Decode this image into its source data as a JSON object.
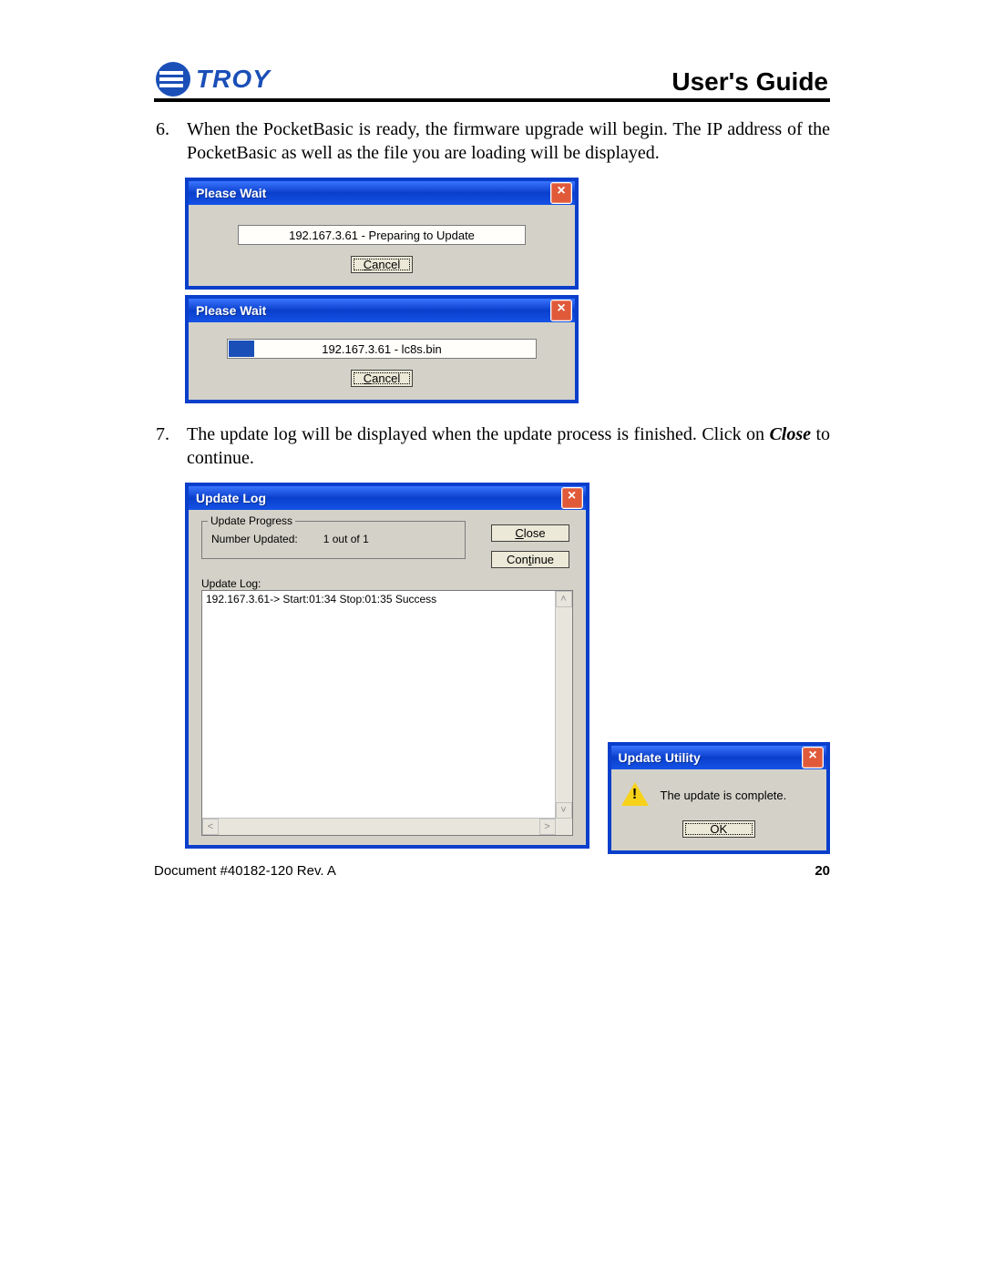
{
  "header": {
    "brand": "TROY",
    "title": "User's Guide"
  },
  "steps": {
    "s6": {
      "num": "6.",
      "text": "When the PocketBasic is ready, the firmware upgrade will begin. The IP address of the PocketBasic as well as the file you are loading will be displayed."
    },
    "s7": {
      "num": "7.",
      "text_a": "The update log will be displayed when the update process is finished.  Click on ",
      "text_b": "Close",
      "text_c": " to continue."
    }
  },
  "dlg1": {
    "title": "Please Wait",
    "status": "192.167.3.61 - Preparing to Update",
    "cancel": "Cancel"
  },
  "dlg2": {
    "title": "Please Wait",
    "status": "192.167.3.61 - lc8s.bin",
    "cancel": "Cancel"
  },
  "updatelog": {
    "title": "Update Log",
    "groupbox": "Update Progress",
    "numupd_label": "Number Updated:",
    "numupd_value": "1   out of   1",
    "close": "Close",
    "continue": "Continue",
    "loglabel": "Update Log:",
    "logline": "192.167.3.61-> Start:01:34 Stop:01:35  Success"
  },
  "utility": {
    "title": "Update Utility",
    "message": "The update is complete.",
    "ok": "OK"
  },
  "footer": {
    "doc": "Document #40182-120  Rev. A",
    "page": "20"
  }
}
